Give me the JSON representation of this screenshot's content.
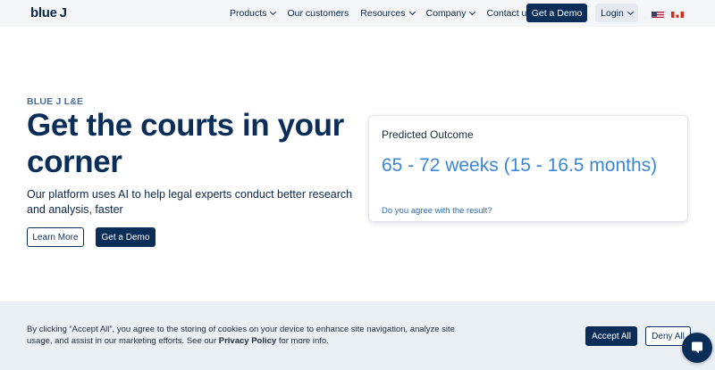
{
  "nav": {
    "logo_word": "blue",
    "logo_letter": "J",
    "items": [
      {
        "label": "Products",
        "dropdown": true
      },
      {
        "label": "Our customers",
        "dropdown": false
      },
      {
        "label": "Resources",
        "dropdown": true
      },
      {
        "label": "Company",
        "dropdown": true
      },
      {
        "label": "Contact us",
        "dropdown": false
      }
    ],
    "demo_label": "Get a Demo",
    "login_label": "Login",
    "flags": [
      "us-flag-icon",
      "ca-flag-icon"
    ]
  },
  "hero": {
    "eyebrow": "BLUE J L&E",
    "headline": "Get the courts in your corner",
    "subtext": "Our platform uses AI to help legal experts conduct better research and analysis, faster",
    "learn_more_label": "Learn More",
    "demo_label": "Get a Demo"
  },
  "card": {
    "title": "Predicted Outcome",
    "value": "65 - 72 weeks (15 - 16.5 months)",
    "link": "Do you agree with the result?"
  },
  "cookie": {
    "text_before": "By clicking “Accept All”, you agree to the storing of cookies on your device to enhance site navigation, analyze site usage, and assist in our marketing efforts. See our ",
    "policy_link": "Privacy Policy",
    "text_after": " for more info.",
    "accept_label": "Accept All",
    "deny_label": "Deny All"
  },
  "colors": {
    "brand_navy": "#0b2e59",
    "accent_blue": "#3a86d6",
    "banner_bg": "#eaeff4"
  }
}
